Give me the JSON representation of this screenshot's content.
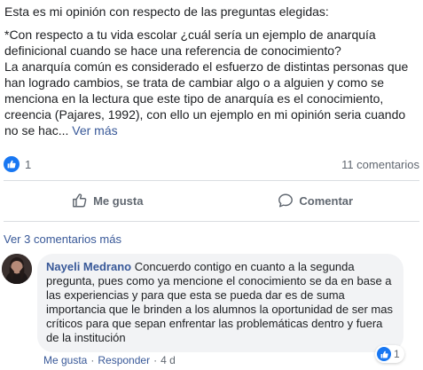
{
  "post": {
    "intro": "Esta es mi opinión con respecto de las preguntas elegidas:",
    "question": "*Con respecto a tu vida escolar ¿cuál sería un ejemplo de anarquía definicional cuando se hace una referencia de conocimiento?",
    "answer": "La anarquía común es considerado el esfuerzo de distintas personas que han logrado cambios, se trata de cambiar algo o a alguien y como se menciona en la lectura que este tipo de anarquía es el conocimiento, creencia (Pajares, 1992), con ello un ejemplo en mi opinión seria cuando no se hac...",
    "see_more": "Ver más"
  },
  "stats": {
    "like_count": "1",
    "comments_count": "11 comentarios"
  },
  "actions": {
    "like_label": "Me gusta",
    "comment_label": "Comentar"
  },
  "comments": {
    "more_link": "Ver 3 comentarios más",
    "item": {
      "author": "Nayeli Medrano",
      "text": "Concuerdo contigo en cuanto a la segunda pregunta, pues como ya mencione el conocimiento se da en base a las experiencias y para que esta se pueda dar es de suma importancia que le brinden a los alumnos la oportunidad de ser mas críticos para que sepan enfrentar las problemáticas dentro y fuera de la institución",
      "reaction_count": "1",
      "like_link": "Me gusta",
      "reply_link": "Responder",
      "separator": "·",
      "time": "4 d"
    }
  },
  "colors": {
    "accent": "#1877f2",
    "link": "#385898",
    "muted": "#606770",
    "bubble": "#f2f3f5"
  },
  "icons": [
    "like-thumb-icon",
    "comment-bubble-icon"
  ]
}
